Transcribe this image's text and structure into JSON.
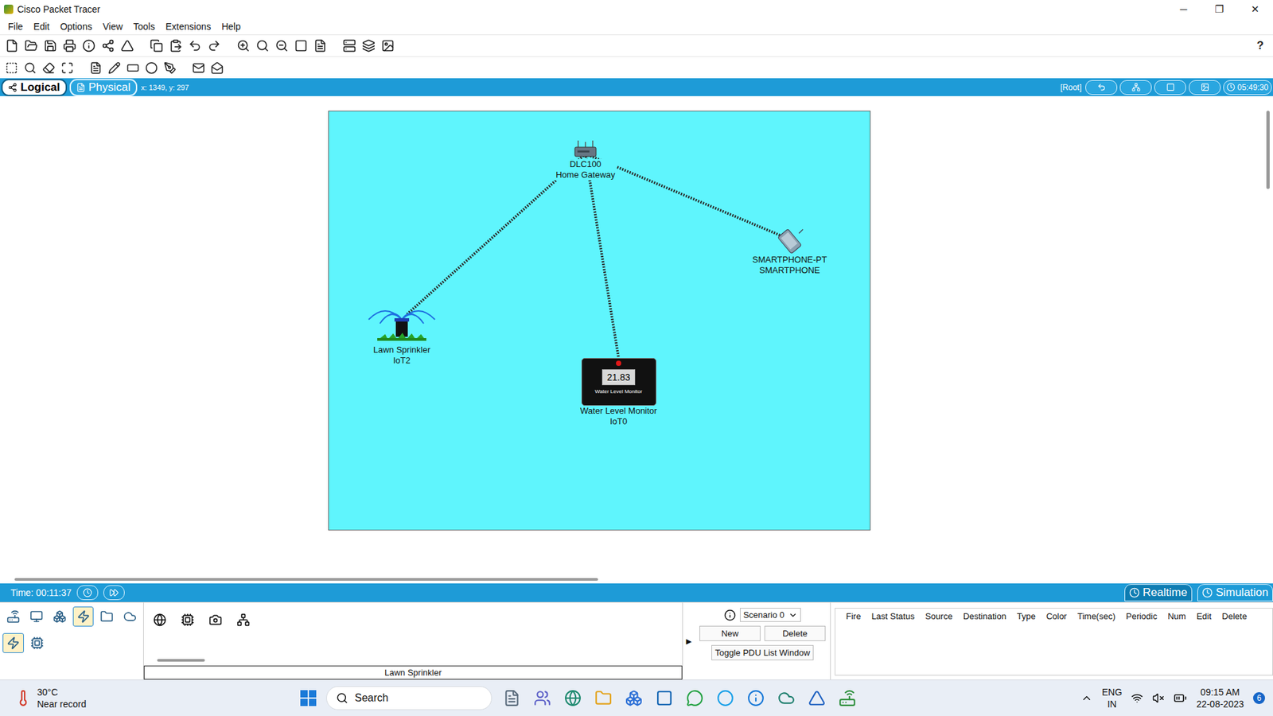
{
  "window": {
    "title": "Cisco Packet Tracer",
    "controls": [
      "─",
      "❐",
      "✕"
    ]
  },
  "menu": [
    "File",
    "Edit",
    "Options",
    "View",
    "Tools",
    "Extensions",
    "Help"
  ],
  "help": "?",
  "workspace_tabs": [
    {
      "label": "Logical",
      "selected": true
    },
    {
      "label": "Physical",
      "selected": false
    }
  ],
  "cursor": "x: 1349, y: 297",
  "path": "[Root]",
  "clock": "05:49:30",
  "nodes": [
    {
      "kind": "gateway",
      "name": "DLC100",
      "label": "Home Gateway"
    },
    {
      "kind": "sprinkler",
      "name": "Lawn Sprinkler",
      "label": "IoT2",
      "on": true
    },
    {
      "kind": "monitor",
      "name": "Water Level Monitor",
      "label": "IoT0",
      "reading": "21.83",
      "face": "Water Level Monitor",
      "led": true
    },
    {
      "kind": "smartphone",
      "name": "SMARTPHONE-PT",
      "label": "SMARTPHONE"
    }
  ],
  "links": [
    {
      "from": 0,
      "to": 1
    },
    {
      "from": 0,
      "to": 2
    },
    {
      "from": 0,
      "to": 3
    }
  ],
  "time": "Time: 00:11:37",
  "modes": [
    {
      "label": "Realtime",
      "selected": true
    },
    {
      "label": "Simulation",
      "selected": false
    }
  ],
  "categories": [
    {
      "selected": false
    },
    {
      "selected": false
    },
    {
      "selected": false
    },
    {
      "selected": true
    },
    {
      "selected": false
    },
    {
      "selected": false
    }
  ],
  "subcategories": [
    {
      "selected": true
    },
    {
      "selected": false
    }
  ],
  "devices": [
    {
      "selected": false
    },
    {
      "selected": false
    },
    {
      "selected": false
    },
    {
      "selected": false
    }
  ],
  "device_caption": "Lawn Sprinkler",
  "scenario": {
    "collapse": "▶",
    "value": "Scenario 0",
    "buttons": [
      "New",
      "Delete"
    ],
    "toggle": "Toggle PDU List Window"
  },
  "pdu_columns": [
    "Fire",
    "Last Status",
    "Source",
    "Destination",
    "Type",
    "Color",
    "Time(sec)",
    "Periodic",
    "Num",
    "Edit",
    "Delete"
  ],
  "taskbar": {
    "weather": {
      "temp": "30°C",
      "text": "Near record"
    },
    "search": "Search",
    "lang": [
      "ENG",
      "IN"
    ],
    "time": "09:15 AM",
    "date": "22-08-2023",
    "badge": "6"
  }
}
